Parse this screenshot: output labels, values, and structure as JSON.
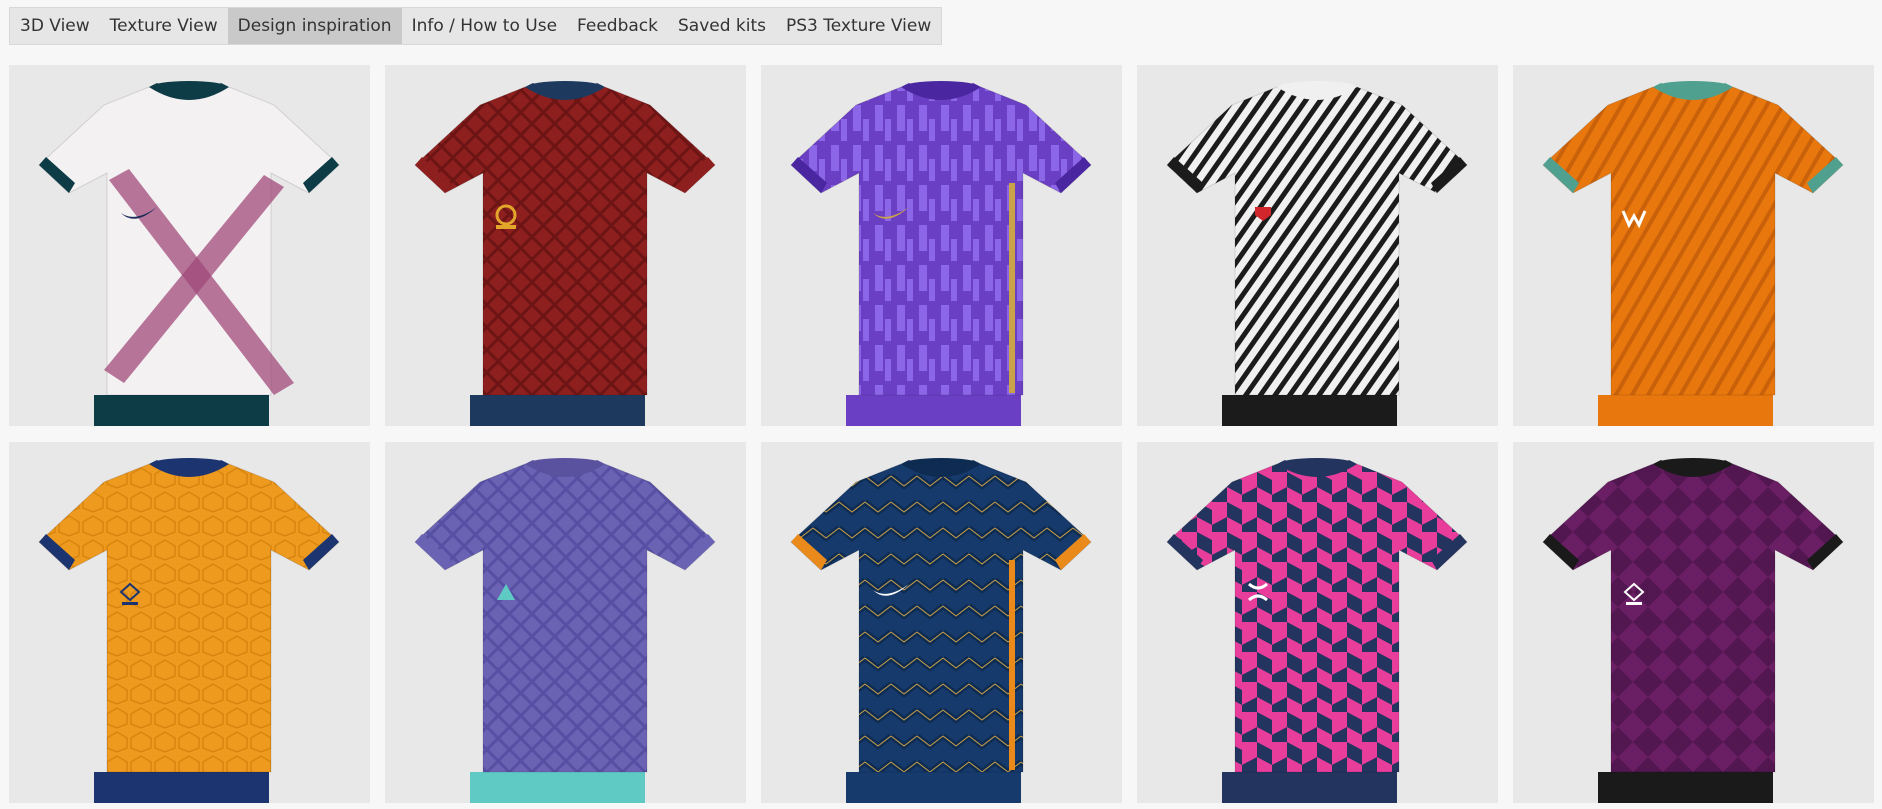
{
  "nav": {
    "tabs": [
      {
        "label": "3D View",
        "active": false
      },
      {
        "label": "Texture View",
        "active": false
      },
      {
        "label": "Design inspiration",
        "active": true
      },
      {
        "label": "Info / How to Use",
        "active": false
      },
      {
        "label": "Feedback",
        "active": false
      },
      {
        "label": "Saved kits",
        "active": false
      },
      {
        "label": "PS3 Texture View",
        "active": false
      }
    ]
  },
  "gallery": {
    "kits": [
      {
        "body": "#f4f1f3",
        "pattern": "cross",
        "accent": "#a04a7a",
        "collar": "#0d3b46",
        "cuff": "#0d3b46",
        "shorts": "#0d3b46",
        "logo": "swoosh",
        "logo_color": "#1d2c5a"
      },
      {
        "body": "#8e1f1f",
        "pattern": "diamond",
        "accent": "#6d1414",
        "collar": "#1d3a5e",
        "cuff": "#8e1f1f",
        "shorts": "#1d3a5e",
        "logo": "round",
        "logo_color": "#e2a62a"
      },
      {
        "body": "#6b3fc4",
        "pattern": "stripes-v",
        "accent": "#8b66e6",
        "collar": "#4a27a0",
        "cuff": "#4a27a0",
        "shorts": "#6b3fc4",
        "logo": "swoosh",
        "logo_color": "#c9a24a"
      },
      {
        "body": "#f0f0f0",
        "pattern": "zebra",
        "accent": "#1b1b1b",
        "collar": "#f0f0f0",
        "cuff": "#1b1b1b",
        "shorts": "#1b1b1b",
        "logo": "badge",
        "logo_color": "#d0262c"
      },
      {
        "body": "#e8780d",
        "pattern": "angles",
        "accent": "#c9610a",
        "collar": "#4fa08e",
        "cuff": "#4fa08e",
        "shorts": "#e8780d",
        "logo": "w",
        "logo_color": "#ffffff"
      },
      {
        "body": "#ee9a1f",
        "pattern": "hex",
        "accent": "#d8850f",
        "collar": "#1c3470",
        "cuff": "#1c3470",
        "shorts": "#1c3470",
        "logo": "diamond",
        "logo_color": "#1c3470"
      },
      {
        "body": "#6a63b4",
        "pattern": "diamond",
        "accent": "#574fa3",
        "collar": "#5a529f",
        "cuff": "#6a63b4",
        "shorts": "#5fc9c4",
        "logo": "tri",
        "logo_color": "#5fc9c4"
      },
      {
        "body": "#153a6b",
        "pattern": "chevron",
        "accent": "#0e2b52",
        "collar": "#0e2b52",
        "cuff": "#ea8a1a",
        "shorts": "#153a6b",
        "logo": "swoosh",
        "logo_color": "#ffffff"
      },
      {
        "body": "#e83d9a",
        "pattern": "checker",
        "accent": "#23345e",
        "collar": "#23345e",
        "cuff": "#23345e",
        "shorts": "#23345e",
        "logo": "ua",
        "logo_color": "#ffffff"
      },
      {
        "body": "#6a1e63",
        "pattern": "tri",
        "accent": "#521650",
        "collar": "#1a1a1a",
        "cuff": "#1a1a1a",
        "shorts": "#1a1a1a",
        "logo": "diamond",
        "logo_color": "#ffffff"
      }
    ]
  }
}
